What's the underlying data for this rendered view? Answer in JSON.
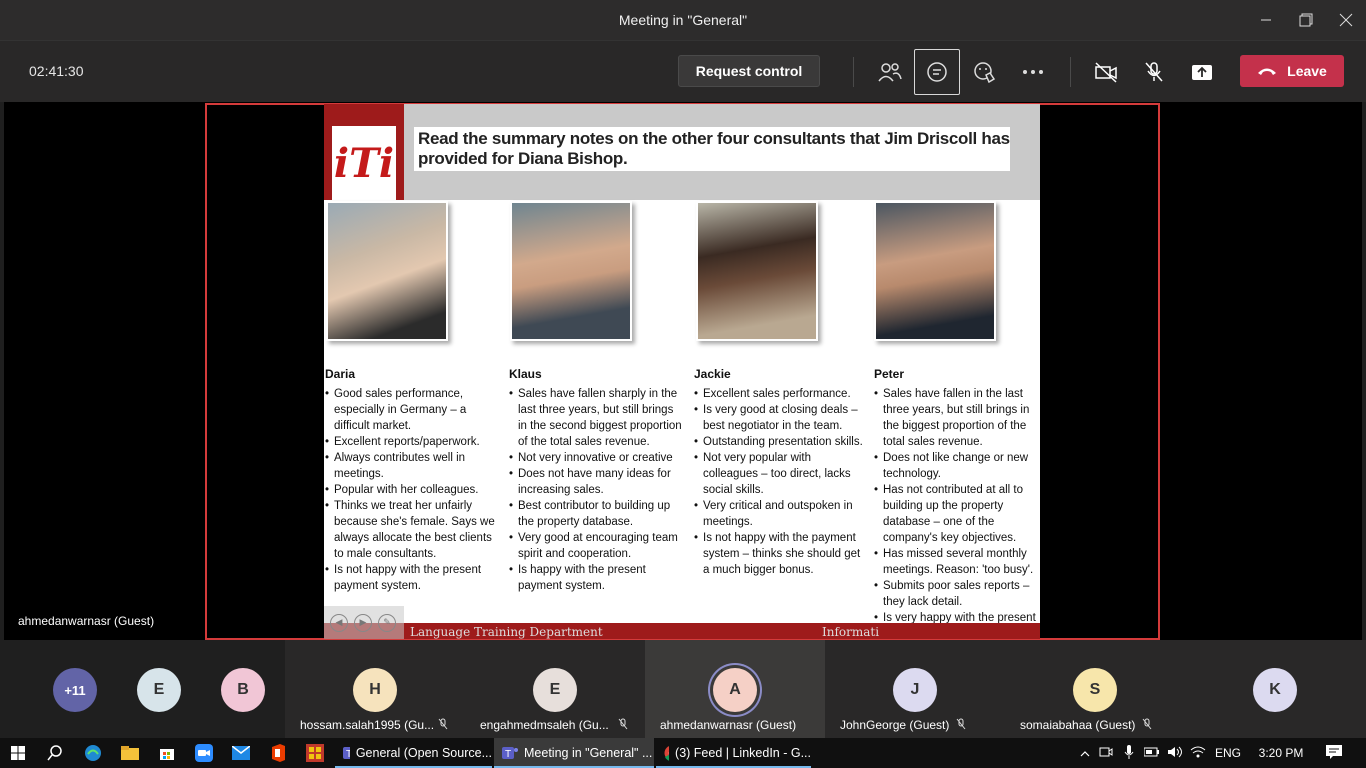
{
  "window": {
    "title": "Meeting in \"General\"",
    "controls": [
      "minimize-icon",
      "restore-icon",
      "close-icon"
    ]
  },
  "toolbar": {
    "timer": "02:41:30",
    "request_control_label": "Request control",
    "leave_label": "Leave",
    "icons": [
      "people-icon",
      "chat-icon",
      "reactions-icon",
      "more-icon",
      "camera-off-icon",
      "mic-off-icon",
      "share-icon",
      "phone-hangup-icon"
    ]
  },
  "stage": {
    "presenter_name": "ahmedanwarnasr (Guest)"
  },
  "slide": {
    "logo_text": "iTi",
    "title": "Read the summary notes on the other four consultants that Jim Driscoll has provided for Diana Bishop.",
    "footer_left": "Language Training Department",
    "footer_right": "Informati",
    "people": [
      {
        "name": "Daria",
        "notes": [
          "Good sales performance, especially in Germany – a difficult market.",
          "Excellent reports/paperwork.",
          "Always contributes well in meetings.",
          "Popular with her colleagues.",
          "Thinks we treat her unfairly because she's female. Says we always allocate the best clients to male consultants.",
          "Is not happy with the present payment system."
        ]
      },
      {
        "name": "Klaus",
        "notes": [
          "Sales have fallen sharply in the last three years, but still brings in the second biggest proportion of the total sales revenue.",
          "Not very innovative or creative",
          "Does not have many ideas for increasing sales.",
          "Best contributor to building up the property database.",
          "Very good at encouraging team spirit and cooperation.",
          "Is happy with the present payment system."
        ]
      },
      {
        "name": "Jackie",
        "notes": [
          "Excellent sales performance.",
          "Is very good at closing deals – best negotiator in the team.",
          "Outstanding presentation skills.",
          "Not very popular with colleagues – too direct, lacks social skills.",
          "Very critical and outspoken in meetings.",
          "Is not happy with the payment system – thinks she should get a much bigger bonus."
        ]
      },
      {
        "name": "Peter",
        "notes": [
          "Sales have fallen in the last three years, but still brings in the biggest proportion of the total sales revenue.",
          "Does not like change or new technology.",
          "Has not contributed at all to building up the property database – one of the company's key objectives.",
          "Has missed several monthly meetings. Reason: 'too busy'.",
          "Submits poor sales reports – they lack detail.",
          "Is very happy with the present payment system."
        ]
      }
    ]
  },
  "participants": {
    "overflow": "+11",
    "small": [
      {
        "initial": "E",
        "color": "#d7e4ea"
      },
      {
        "initial": "B",
        "color": "#f1c6d6"
      }
    ],
    "tiles": [
      {
        "initial": "H",
        "name": "hossam.salah1995 (Gu...",
        "color": "#f6e3bd",
        "muted": true
      },
      {
        "initial": "E",
        "name": "engahmedmsaleh (Gu...",
        "color": "#e7dfdb",
        "muted": true
      },
      {
        "initial": "A",
        "name": "ahmedanwarnasr (Guest)",
        "color": "#f5d0c6",
        "muted": false
      },
      {
        "initial": "J",
        "name": "JohnGeorge (Guest)",
        "color": "#dcdaf0",
        "muted": true
      },
      {
        "initial": "S",
        "name": "somaiabahaa (Guest)",
        "color": "#f7e6ab",
        "muted": true
      },
      {
        "initial": "K",
        "name": "",
        "color": "#dcdaf0",
        "muted": false
      }
    ]
  },
  "taskbar": {
    "apps": [
      {
        "label": "General (Open Source...",
        "active": false
      },
      {
        "label": "Meeting in \"General\" ...",
        "active": true
      },
      {
        "label": "(3) Feed | LinkedIn - G...",
        "active": false
      }
    ],
    "language": "ENG",
    "time": "3:20 PM"
  }
}
